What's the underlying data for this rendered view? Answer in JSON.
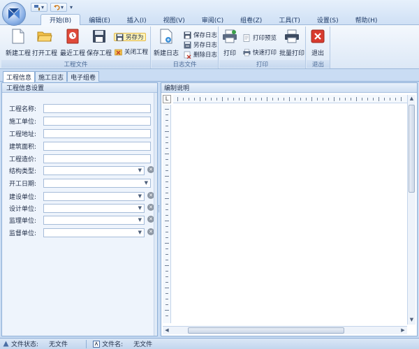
{
  "qat": {
    "dropdown_glyph": "▾",
    "overflow_glyph": "▾"
  },
  "tabs": [
    {
      "label": "开始(B)",
      "active": true
    },
    {
      "label": "编辑(E)"
    },
    {
      "label": "插入(I)"
    },
    {
      "label": "视图(V)"
    },
    {
      "label": "审阅(C)"
    },
    {
      "label": "组卷(Z)"
    },
    {
      "label": "工具(T)"
    },
    {
      "label": "设置(S)"
    },
    {
      "label": "帮助(H)"
    }
  ],
  "ribbon": {
    "project_group": {
      "label": "工程文件",
      "new_project": "新建工程",
      "open_project": "打开工程",
      "recent_project": "最近工程",
      "save_project": "保存工程",
      "save_as": "另存为",
      "close_project": "关闭工程"
    },
    "log_group": {
      "label": "日志文件",
      "new_log": "新建日志",
      "save_log": "保存日志",
      "save_log_as": "另存日志",
      "delete_log": "删除日志"
    },
    "print_group": {
      "label": "打印",
      "print": "打印",
      "print_preview": "打印预览",
      "quick_print": "快速打印",
      "batch_print": "批量打印"
    },
    "exit_group": {
      "label": "退出",
      "exit": "退出"
    }
  },
  "doc_tabs": [
    {
      "label": "工程信息",
      "active": true
    },
    {
      "label": "施工日志"
    },
    {
      "label": "电子组卷"
    }
  ],
  "left_panel": {
    "title": "工程信息设置",
    "fields": [
      {
        "label": "工程名称:",
        "type": "text",
        "value": ""
      },
      {
        "label": "施工单位:",
        "type": "text",
        "value": ""
      },
      {
        "label": "工程地址:",
        "type": "text",
        "value": ""
      },
      {
        "label": "建筑面积:",
        "type": "text",
        "value": ""
      },
      {
        "label": "工程造价:",
        "type": "text",
        "value": ""
      },
      {
        "label": "结构类型:",
        "type": "select",
        "value": ""
      },
      {
        "label": "开工日期:",
        "type": "date",
        "value": ""
      },
      {
        "label": "建设单位:",
        "type": "select",
        "value": ""
      },
      {
        "label": "设计单位:",
        "type": "select",
        "value": ""
      },
      {
        "label": "监理单位:",
        "type": "select",
        "value": ""
      },
      {
        "label": "监督单位:",
        "type": "select",
        "value": ""
      }
    ]
  },
  "right_panel": {
    "title": "编制说明",
    "ruler_corner": "L"
  },
  "statusbar": {
    "file_status_label": "文件状态:",
    "file_status_value": "无文件",
    "file_name_label": "文件名:",
    "file_name_value": "无文件"
  },
  "colors": {
    "frame": "#c9dcf3",
    "ribbon": "#dce8f6",
    "accent_border": "#8daed6",
    "highlight": "#fff4b8"
  }
}
